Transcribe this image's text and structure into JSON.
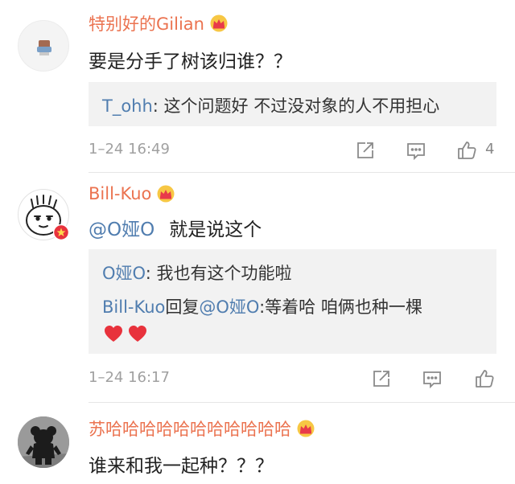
{
  "comments": [
    {
      "username": "特别好的Gilian",
      "text": "要是分手了树该归谁？？",
      "reply_user": "T_ohh",
      "reply_sep": ":",
      "reply_text": " 这个问题好 不过没对象的人不用担心",
      "timestamp": "1–24 16:49",
      "like_count": "4"
    },
    {
      "username": "Bill-Kuo",
      "mention": "@O娅O",
      "text": "就是说这个",
      "replies": [
        {
          "user": "O娅O",
          "sep": ":",
          "text": " 我也有这个功能啦"
        },
        {
          "user": "Bill-Kuo",
          "mid": "回复",
          "mention": "@O娅O",
          "text": ":等着哈 咱俩也种一棵"
        }
      ],
      "timestamp": "1–24 16:17"
    },
    {
      "username": "苏哈哈哈哈哈哈哈哈哈哈哈",
      "text": "谁来和我一起种？？？"
    }
  ],
  "colors": {
    "username": "#eb7350",
    "link": "#507daf",
    "heart": "#e8323c"
  }
}
